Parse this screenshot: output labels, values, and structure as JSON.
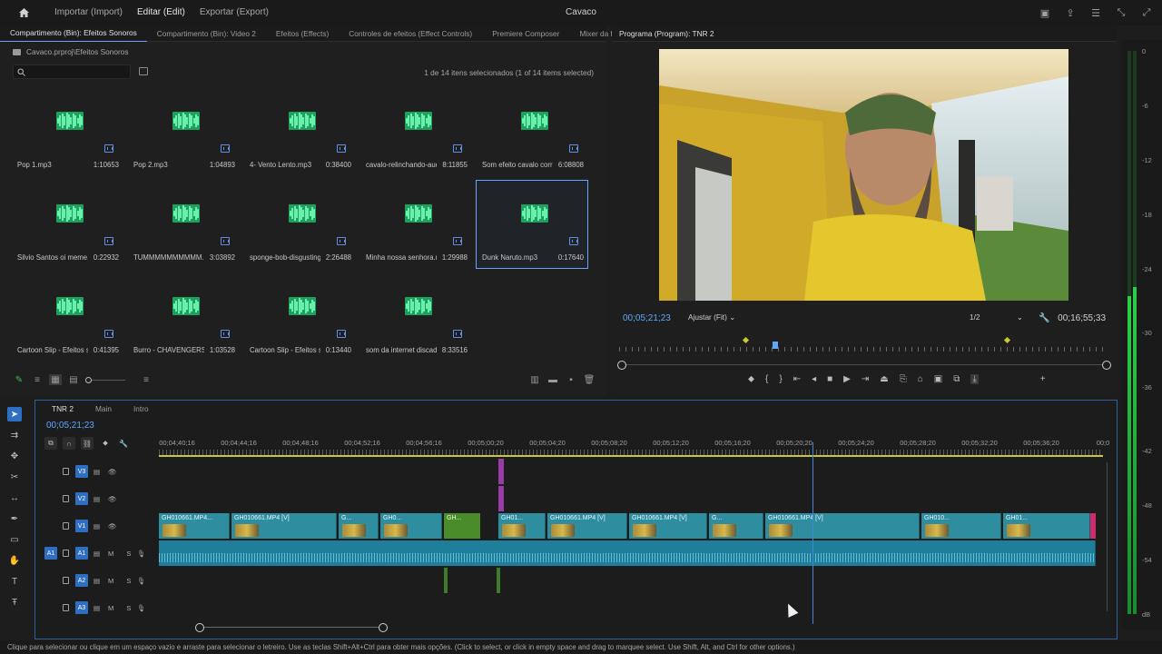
{
  "header": {
    "menu": [
      "Importar (Import)",
      "Editar (Edit)",
      "Exportar (Export)"
    ],
    "active_menu": "Editar (Edit)",
    "title": "Cavaco"
  },
  "bin": {
    "tabs": [
      "Compartimento (Bin): Efeitos Sonoros",
      "Compartimento (Bin): Video 2",
      "Efeitos (Effects)",
      "Controles de efeitos (Effect Controls)",
      "Premiere Composer",
      "Mixer da fa"
    ],
    "path": "Cavaco.prproj\\Efeitos Sonoros",
    "search_placeholder": "",
    "selection": "1 de 14 itens selecionados (1 of 14 items selected)",
    "items": [
      {
        "name": "Pop 1.mp3",
        "duration": "1:10653"
      },
      {
        "name": "Pop 2.mp3",
        "duration": "1:04893"
      },
      {
        "name": "4- Vento Lento.mp3",
        "duration": "0:38400"
      },
      {
        "name": "cavalo-relinchando-audi...",
        "duration": "8:11855"
      },
      {
        "name": "Som efeito cavalo corre...",
        "duration": "6:08808"
      },
      {
        "name": "Silvio Santos oi meme...",
        "duration": "0:22932"
      },
      {
        "name": "TUMMMMMMMMMM...",
        "duration": "3:03892"
      },
      {
        "name": "sponge-bob-disgusting-...",
        "duration": "2:26488"
      },
      {
        "name": "Minha nossa senhora.mp3",
        "duration": "1:29988"
      },
      {
        "name": "Dunk Naruto.mp3",
        "duration": "0:17640",
        "selected": true
      },
      {
        "name": "Cartoon Slip - Efeitos so...",
        "duration": "0:41395"
      },
      {
        "name": "Burro - CHAVENGERS (...",
        "duration": "1:03528"
      },
      {
        "name": "Cartoon Slip - Efeitos so...",
        "duration": "0:13440"
      },
      {
        "name": "som da internet discada...",
        "duration": "8:33516"
      }
    ]
  },
  "program": {
    "title": "Programa (Program): TNR 2",
    "timecode": "00;05;21;23",
    "fit": "Ajustar (Fit)",
    "resolution": "1/2",
    "duration": "00;16;55;33"
  },
  "timeline": {
    "tabs": [
      "TNR 2",
      "Main",
      "Intro"
    ],
    "timecode": "00;05;21;23",
    "ruler": [
      "00;04;40;16",
      "00;04;44;16",
      "00;04;48;16",
      "00;04;52;16",
      "00;04;56;16",
      "00;05;00;20",
      "00;05;04;20",
      "00;05;08;20",
      "00;05;12;20",
      "00;05;16;20",
      "00;05;20;20",
      "00;05;24;20",
      "00;05;28;20",
      "00;05;32;20",
      "00;05;36;20",
      "00;0"
    ],
    "tracks": [
      {
        "target": "",
        "name": "V3",
        "extras": ""
      },
      {
        "target": "",
        "name": "V2",
        "extras": ""
      },
      {
        "target": "",
        "name": "V1",
        "extras": ""
      },
      {
        "target": "A1",
        "name": "A1",
        "extras": "M S"
      },
      {
        "target": "",
        "name": "A2",
        "extras": "M S"
      },
      {
        "target": "",
        "name": "A3",
        "extras": "M S"
      }
    ],
    "clips": [
      {
        "label": "GH010661.MP4..."
      },
      {
        "label": "GH010661.MP4 [V]"
      },
      {
        "label": "G..."
      },
      {
        "label": "GH0..."
      },
      {
        "label": "GH..."
      },
      {
        "label": "GH01..."
      },
      {
        "label": "GH010661.MP4 [V]"
      },
      {
        "label": "GH010661.MP4 [V]"
      },
      {
        "label": "G..."
      },
      {
        "label": "GH010661.MP4 [V]"
      },
      {
        "label": "GH010..."
      },
      {
        "label": "GH01..."
      }
    ]
  },
  "meters": {
    "scale": [
      "0",
      "-6",
      "-12",
      "-18",
      "-24",
      "-30",
      "-36",
      "-42",
      "-48",
      "-54",
      "dB"
    ]
  },
  "status": "Clique para selecionar ou clique em um espaço vazio e arraste para selecionar o letreiro. Use as teclas Shift+Alt+Ctrl para obter mais opções. (Click to select, or click in empty space and drag to marquee select. Use Shift, Alt, and Ctrl for other options.)"
}
